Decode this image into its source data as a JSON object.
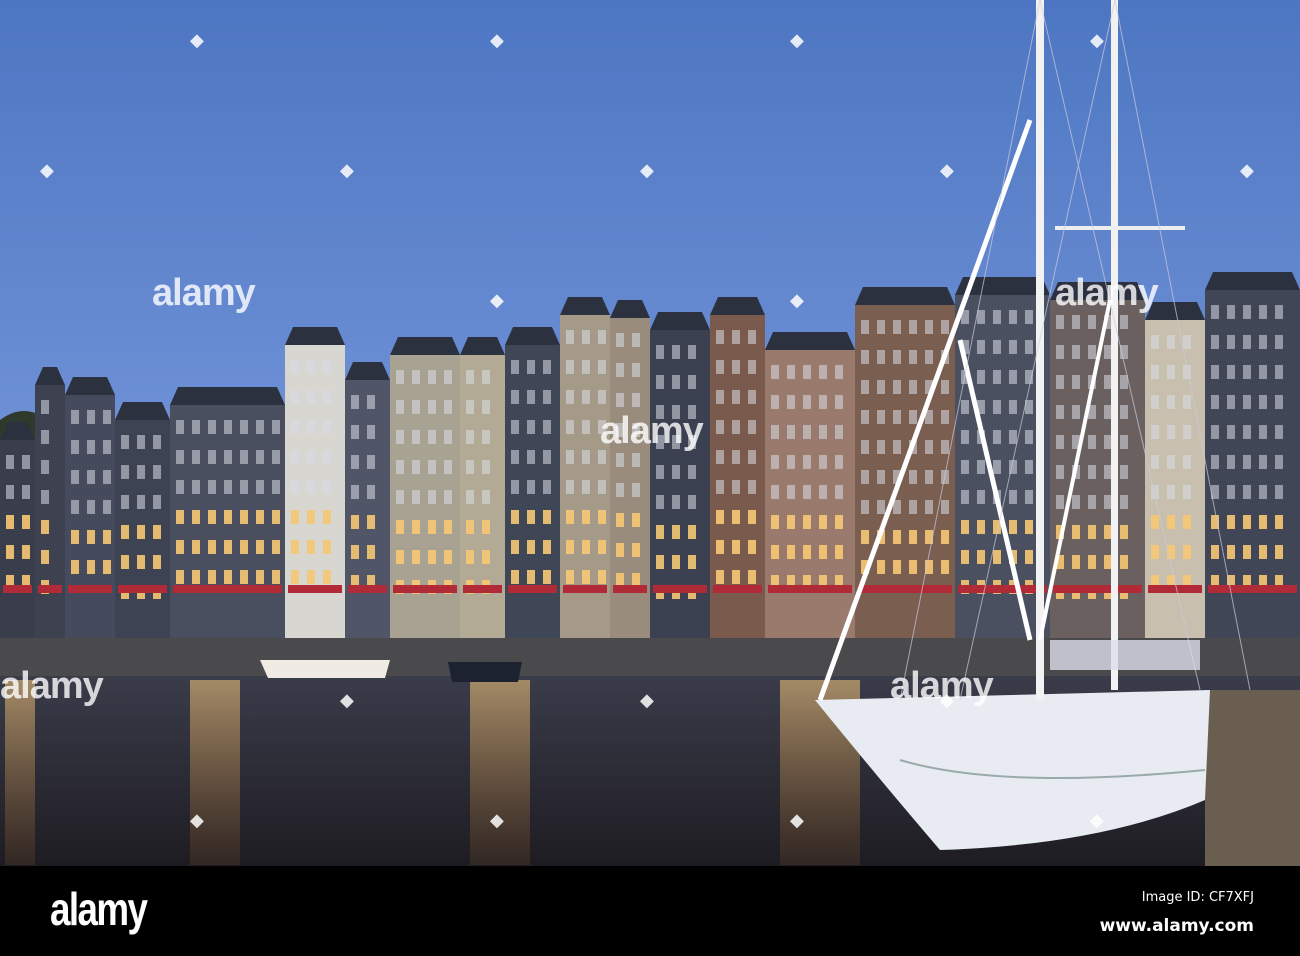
{
  "photo": {
    "watermark_text": "alamy",
    "colors": {
      "sky_top": "#4f78c4",
      "sky_bottom": "#7d9be0",
      "water": "#2c2c36",
      "light": "#ffce7a"
    }
  },
  "footer": {
    "logo": "alamy",
    "image_id": "Image ID: CF7XFJ",
    "url": "www.alamy.com"
  }
}
